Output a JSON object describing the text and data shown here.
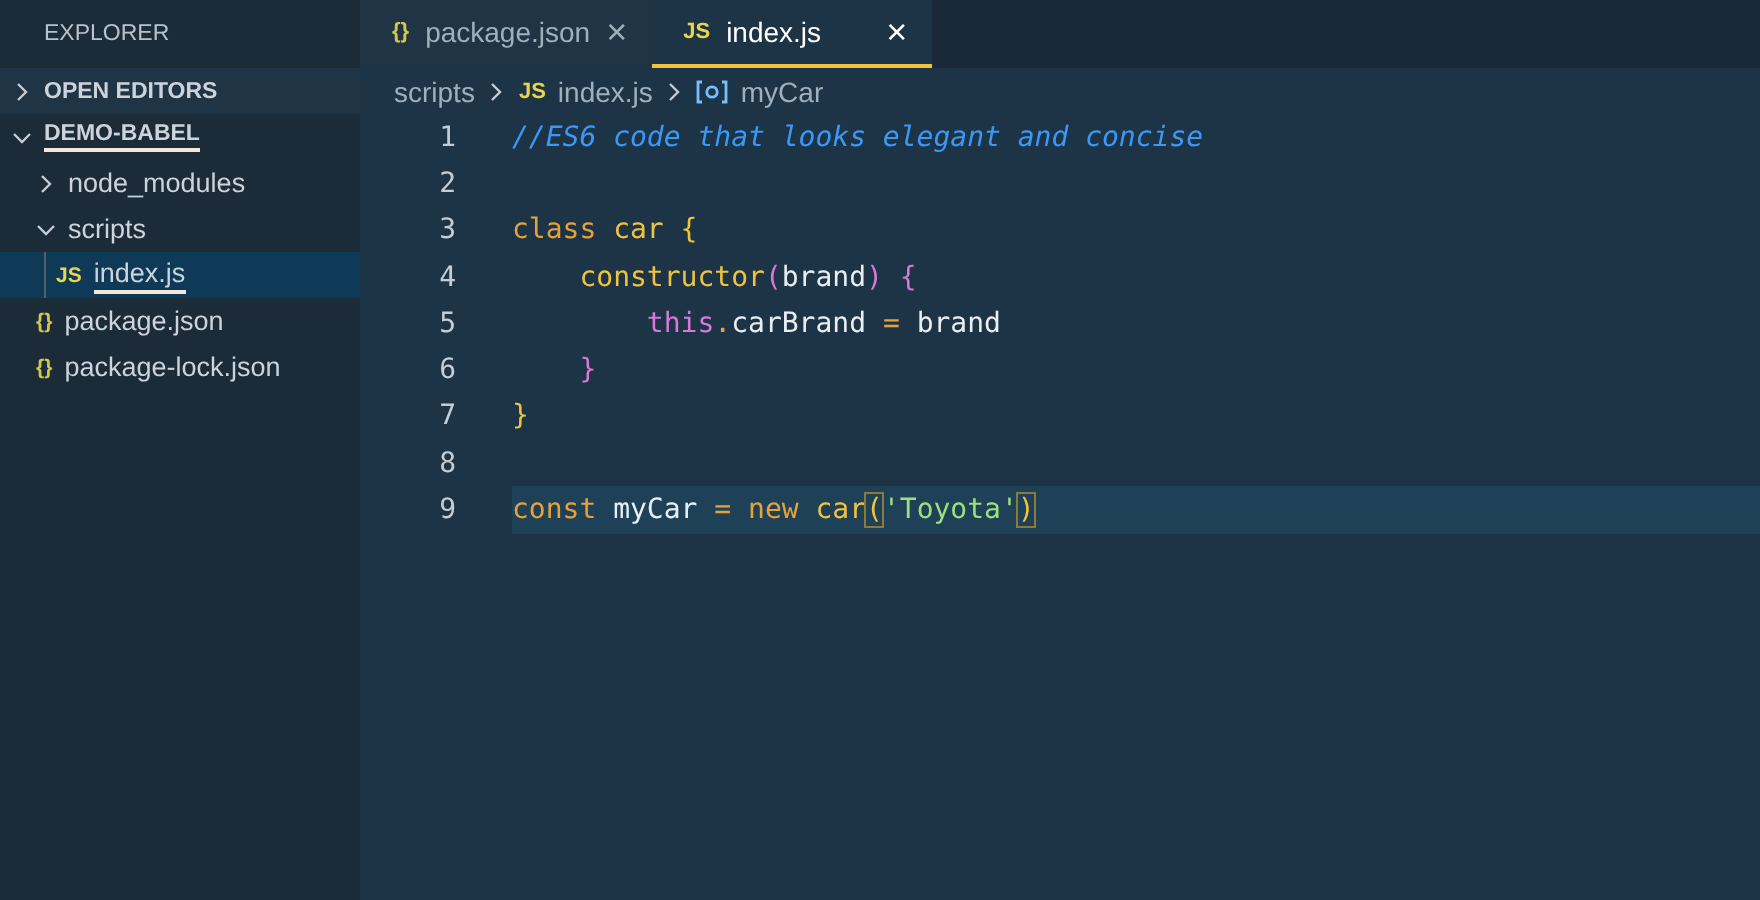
{
  "sidebar": {
    "title": "EXPLORER",
    "sections": [
      {
        "label": "OPEN EDITORS",
        "expanded": false,
        "underlined": false
      },
      {
        "label": "DEMO-BABEL",
        "expanded": true,
        "underlined": true,
        "children": [
          {
            "label": "node_modules",
            "kind": "folder",
            "expanded": false,
            "selected": false,
            "underlined": false
          },
          {
            "label": "scripts",
            "kind": "folder",
            "expanded": true,
            "selected": false,
            "underlined": false,
            "children": [
              {
                "label": "index.js",
                "kind": "js",
                "icon": "JS",
                "selected": true,
                "underlined": true
              }
            ]
          },
          {
            "label": "package.json",
            "kind": "json",
            "icon": "{}",
            "selected": false,
            "underlined": false
          },
          {
            "label": "package-lock.json",
            "kind": "json",
            "icon": "{}",
            "selected": false,
            "underlined": false
          }
        ]
      }
    ]
  },
  "tabs": [
    {
      "label": "package.json",
      "kind": "json",
      "icon": "{}",
      "close": "×",
      "selected": false
    },
    {
      "label": "index.js",
      "kind": "js",
      "icon": "JS",
      "close": "×",
      "selected": true
    }
  ],
  "breadcrumb": [
    {
      "kind": "folder",
      "label": "scripts"
    },
    {
      "kind": "js",
      "icon": "JS",
      "label": "index.js"
    },
    {
      "kind": "symbol",
      "label": "myCar"
    }
  ],
  "editor": {
    "lines": [
      {
        "number": "1",
        "current": false,
        "tokens": [
          {
            "kind": "comment",
            "text": "//ES6 code that looks elegant and concise"
          }
        ]
      },
      {
        "number": "2",
        "current": false
      },
      {
        "number": "3",
        "current": false,
        "tokens": [
          {
            "kind": "keyword",
            "text": "class "
          },
          {
            "kind": "entity",
            "text": "car "
          },
          {
            "kind": "brace",
            "text": "{"
          }
        ]
      },
      {
        "number": "4",
        "current": false,
        "tokens": [
          {
            "kind": "entity",
            "text": "    constructor"
          },
          {
            "kind": "paren",
            "text": "("
          },
          {
            "kind": "plain",
            "text": "brand"
          },
          {
            "kind": "paren",
            "text": ") {"
          }
        ]
      },
      {
        "number": "5",
        "current": false,
        "tokens": [
          {
            "kind": "this",
            "text": "        this"
          },
          {
            "kind": "keyword",
            "text": "."
          },
          {
            "kind": "plain",
            "text": "carBrand "
          },
          {
            "kind": "keyword",
            "text": "= "
          },
          {
            "kind": "plain",
            "text": "brand"
          }
        ]
      },
      {
        "number": "6",
        "current": false,
        "tokens": [
          {
            "kind": "paren",
            "text": "    }"
          }
        ]
      },
      {
        "number": "7",
        "current": false,
        "tokens": [
          {
            "kind": "brace",
            "text": "}"
          }
        ]
      },
      {
        "number": "8",
        "current": false
      },
      {
        "number": "9",
        "current": true,
        "tokens": [
          {
            "kind": "keyword",
            "text": "const "
          },
          {
            "kind": "plain",
            "text": "myCar "
          },
          {
            "kind": "keyword",
            "text": "= new "
          },
          {
            "kind": "entity",
            "text": "car"
          },
          {
            "kind": "match",
            "text": "("
          },
          {
            "kind": "string",
            "text": "'Toyota'"
          },
          {
            "kind": "match",
            "text": ")"
          }
        ]
      }
    ]
  }
}
